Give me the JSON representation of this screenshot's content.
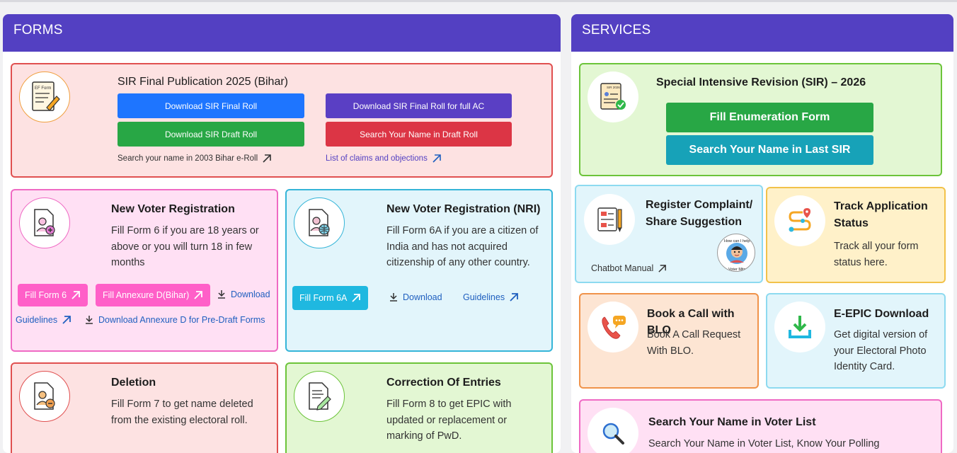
{
  "forms": {
    "header": "FORMS",
    "sir_card": {
      "title": "SIR Final Publication 2025 (Bihar)",
      "icon_label": "EF Form",
      "btn_final_roll": "Download SIR Final Roll",
      "btn_final_roll_full_ac": "Download SIR Final Roll for full AC",
      "btn_draft_roll": "Download SIR Draft Roll",
      "btn_search_draft": "Search Your Name in Draft Roll",
      "link_2003": "Search your name in 2003 Bihar e-Roll",
      "link_claims": "List of claims and objections"
    },
    "new_voter": {
      "title": "New Voter Registration",
      "desc": "Fill Form 6 if you are 18 years or above or you will turn 18 in few months",
      "btn_fill_form6": "Fill Form 6",
      "btn_annexure": "Fill Annexure D(Bihar)",
      "link_download": "Download",
      "link_guidelines": "Guidelines",
      "link_download_annexure": "Download Annexure D for Pre-Draft Forms"
    },
    "nri": {
      "title": "New Voter Registration (NRI)",
      "desc": "Fill Form 6A if you are a citizen of India and has not acquired citizenship of any other country.",
      "btn_fill_form6a": "Fill Form 6A",
      "link_download": "Download",
      "link_guidelines": "Guidelines"
    },
    "deletion": {
      "title": "Deletion",
      "desc": "Fill Form 7 to get name deleted from the existing electoral roll."
    },
    "correction": {
      "title": "Correction Of Entries",
      "desc": "Fill Form 8 to get EPIC with updated or replacement or marking of PwD."
    }
  },
  "services": {
    "header": "SERVICES",
    "sir_2026": {
      "title": "Special Intensive Revision (SIR) – 2026",
      "icon_label": "SIR 2026",
      "btn_fill_enum": "Fill Enumeration Form",
      "btn_search_last": "Search Your Name in Last SIR"
    },
    "complaint": {
      "title": "Register Complaint/ Share Suggestion",
      "link_chatbot": "Chatbot Manual",
      "badge_top": "How can I help?",
      "badge_bottom": "Voter Mitra"
    },
    "track": {
      "title": "Track Application Status",
      "desc": "Track all your form status here."
    },
    "blo": {
      "title": "Book a Call with BLO",
      "desc": "Book A Call Request With BLO."
    },
    "epic": {
      "title": "E-EPIC Download",
      "desc": "Get digital version of your Electoral Photo Identity Card."
    },
    "search_voter": {
      "title": "Search Your Name in Voter List",
      "desc": "Search Your Name in Voter List, Know Your Polling"
    }
  },
  "colors": {
    "header_purple": "#5340c2",
    "btn_blue": "#1e75ff",
    "btn_purple": "#5a3fc4",
    "btn_green": "#28a745",
    "btn_red": "#dc3545",
    "btn_pink": "#ff5fc8",
    "btn_cyan": "#1fb8e0",
    "btn_teal": "#17a2b8"
  }
}
